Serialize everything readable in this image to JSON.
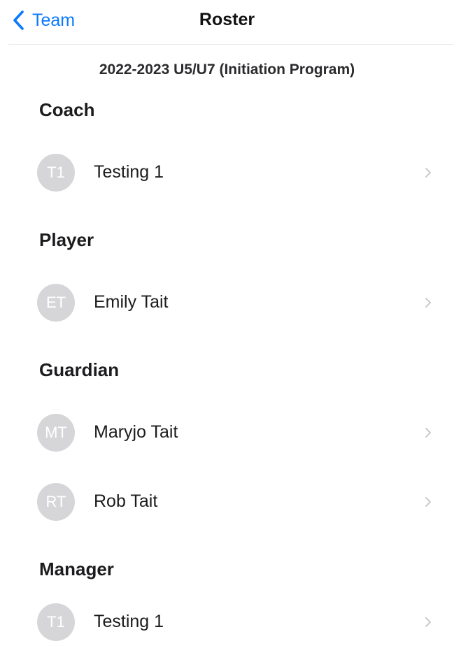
{
  "nav": {
    "back_label": "Team",
    "title": "Roster"
  },
  "program_title": "2022-2023 U5/U7 (Initiation Program)",
  "sections": [
    {
      "header": "Coach",
      "members": [
        {
          "initials": "T1",
          "name": "Testing 1"
        }
      ]
    },
    {
      "header": "Player",
      "members": [
        {
          "initials": "ET",
          "name": "Emily Tait"
        }
      ]
    },
    {
      "header": "Guardian",
      "members": [
        {
          "initials": "MT",
          "name": "Maryjo Tait"
        },
        {
          "initials": "RT",
          "name": "Rob Tait"
        }
      ]
    },
    {
      "header": "Manager",
      "members": [
        {
          "initials": "T1",
          "name": "Testing 1"
        }
      ]
    }
  ],
  "colors": {
    "accent": "#0a7aff",
    "avatar_bg": "#d6d6d8",
    "chevron": "#c4c4c7"
  }
}
